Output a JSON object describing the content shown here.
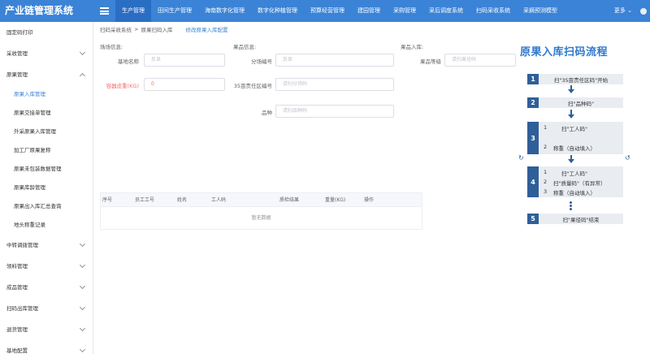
{
  "app": {
    "title": "产业链管理系统"
  },
  "nav": {
    "items": [
      {
        "label": "生产管理",
        "active": true
      },
      {
        "label": "田间生产管理"
      },
      {
        "label": "海南数字化管理"
      },
      {
        "label": "数字化种植管理"
      },
      {
        "label": "预算经营管理"
      },
      {
        "label": "建园管理"
      },
      {
        "label": "采购管理"
      },
      {
        "label": "采后调度系统"
      },
      {
        "label": "扫码采收系统"
      },
      {
        "label": "采摘预测模型"
      }
    ],
    "more": "更多",
    "more_icon": "chevron-down-icon"
  },
  "sidebar": {
    "items": [
      {
        "label": "固定码打印",
        "expandable": false
      },
      {
        "label": "采收管理",
        "expandable": true,
        "open": false
      },
      {
        "label": "原果管理",
        "expandable": true,
        "open": true,
        "children": [
          {
            "label": "原果入库管理",
            "active": true
          },
          {
            "label": "原果交接单管理"
          },
          {
            "label": "外采原果入库管理"
          },
          {
            "label": "加工厂原果复称"
          },
          {
            "label": "原果未包装数据管理"
          },
          {
            "label": "原果库龄管理"
          },
          {
            "label": "原果出入库汇总查询"
          },
          {
            "label": "地头称重记录"
          }
        ]
      },
      {
        "label": "中转调拨管理",
        "expandable": true
      },
      {
        "label": "领料管理",
        "expandable": true
      },
      {
        "label": "成品管理",
        "expandable": true
      },
      {
        "label": "扫码出库管理",
        "expandable": true
      },
      {
        "label": "退货管理",
        "expandable": true
      },
      {
        "label": "基地配置",
        "expandable": true
      }
    ]
  },
  "breadcrumb": {
    "items": [
      "扫码采收系统",
      "原果扫码入库"
    ],
    "link": "修改原果入库配置"
  },
  "form": {
    "sections": {
      "field_info": "场场信息:",
      "block_info": "果品信息:",
      "storage_info": "果品入库:"
    },
    "base_name": {
      "label": "基地名称",
      "placeholder": "反显"
    },
    "block_code": {
      "label": "分场编号",
      "placeholder": "反显"
    },
    "grade": {
      "label": "果品等级",
      "placeholder": "请扫果径码"
    },
    "weight": {
      "label": "容器皮重(KG)",
      "value": "0"
    },
    "zone_code": {
      "label": "35亩责任区编号",
      "placeholder": "请扫分场码"
    },
    "variety": {
      "label": "品种",
      "placeholder": "请扫品种码"
    }
  },
  "table": {
    "columns": [
      "序号",
      "员工工号",
      "姓名",
      "工人码",
      "质检结果",
      "重量(KG)",
      "操作"
    ],
    "empty_text": "暂无数据"
  },
  "flow": {
    "title": "原果入库扫码流程",
    "steps": [
      {
        "num": "1",
        "text": "扫\"35亩责任区码\"开始"
      },
      {
        "num": "2",
        "text": "扫\"品种码\""
      },
      {
        "num": "3",
        "lines": [
          "1",
          "扫\"工人码\"",
          "2",
          "称重（自动填入）"
        ]
      },
      {
        "num": "4",
        "lines": [
          "1",
          "扫\"工人码\"",
          "2",
          "扫\"质量码\"（有异常）",
          "3",
          "称重（自动填入）"
        ]
      },
      {
        "num": "5",
        "text": "扫\"果径码\"结束"
      }
    ]
  },
  "colors": {
    "primary": "#3b83d6",
    "nav_active": "#2a6ec4",
    "flow_dark": "#2f5f98",
    "flow_title": "#2f78cc",
    "danger": "#f56c6c"
  }
}
